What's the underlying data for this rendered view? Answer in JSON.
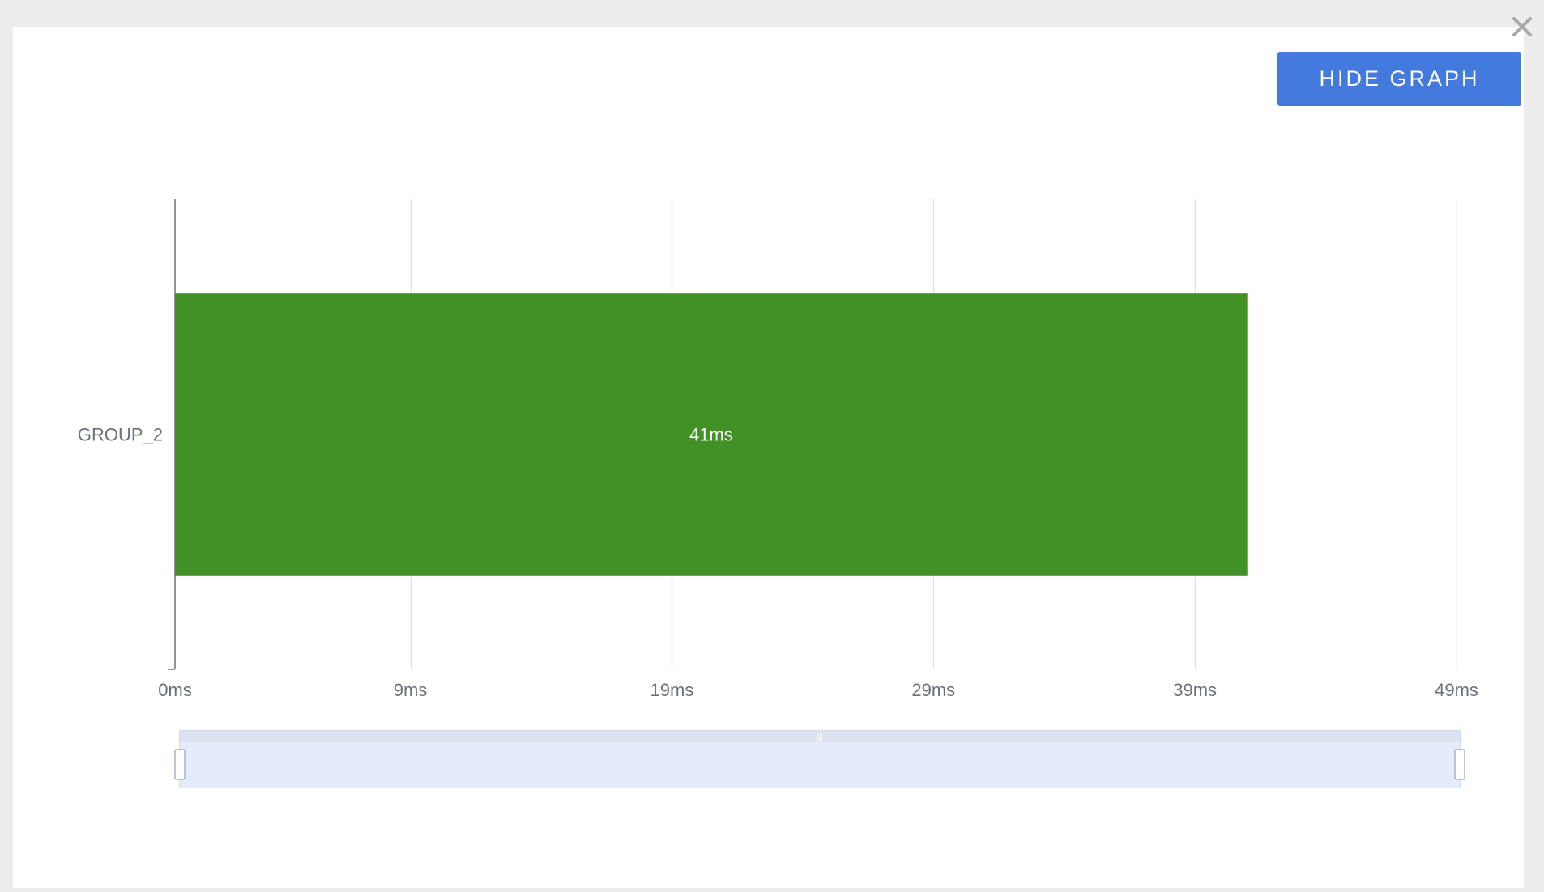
{
  "dialog": {
    "close_icon": "close-icon",
    "hide_graph_label": "HIDE GRAPH"
  },
  "colors": {
    "bar": "#429127",
    "button": "#4479de",
    "grid": "#dfe2f2",
    "axis": "#6e7079",
    "zoom_fill": "#e6ebfc",
    "zoom_border": "#c6cde6"
  },
  "chart_data": {
    "type": "bar",
    "orientation": "horizontal",
    "categories": [
      "GROUP_2"
    ],
    "values": [
      41
    ],
    "value_labels": [
      "41ms"
    ],
    "unit": "ms",
    "x_ticks": [
      "0ms",
      "9ms",
      "19ms",
      "29ms",
      "39ms",
      "49ms"
    ],
    "xlim": [
      0,
      49
    ],
    "grid": true,
    "zoom_slider": {
      "start": 0,
      "end": 1
    }
  }
}
